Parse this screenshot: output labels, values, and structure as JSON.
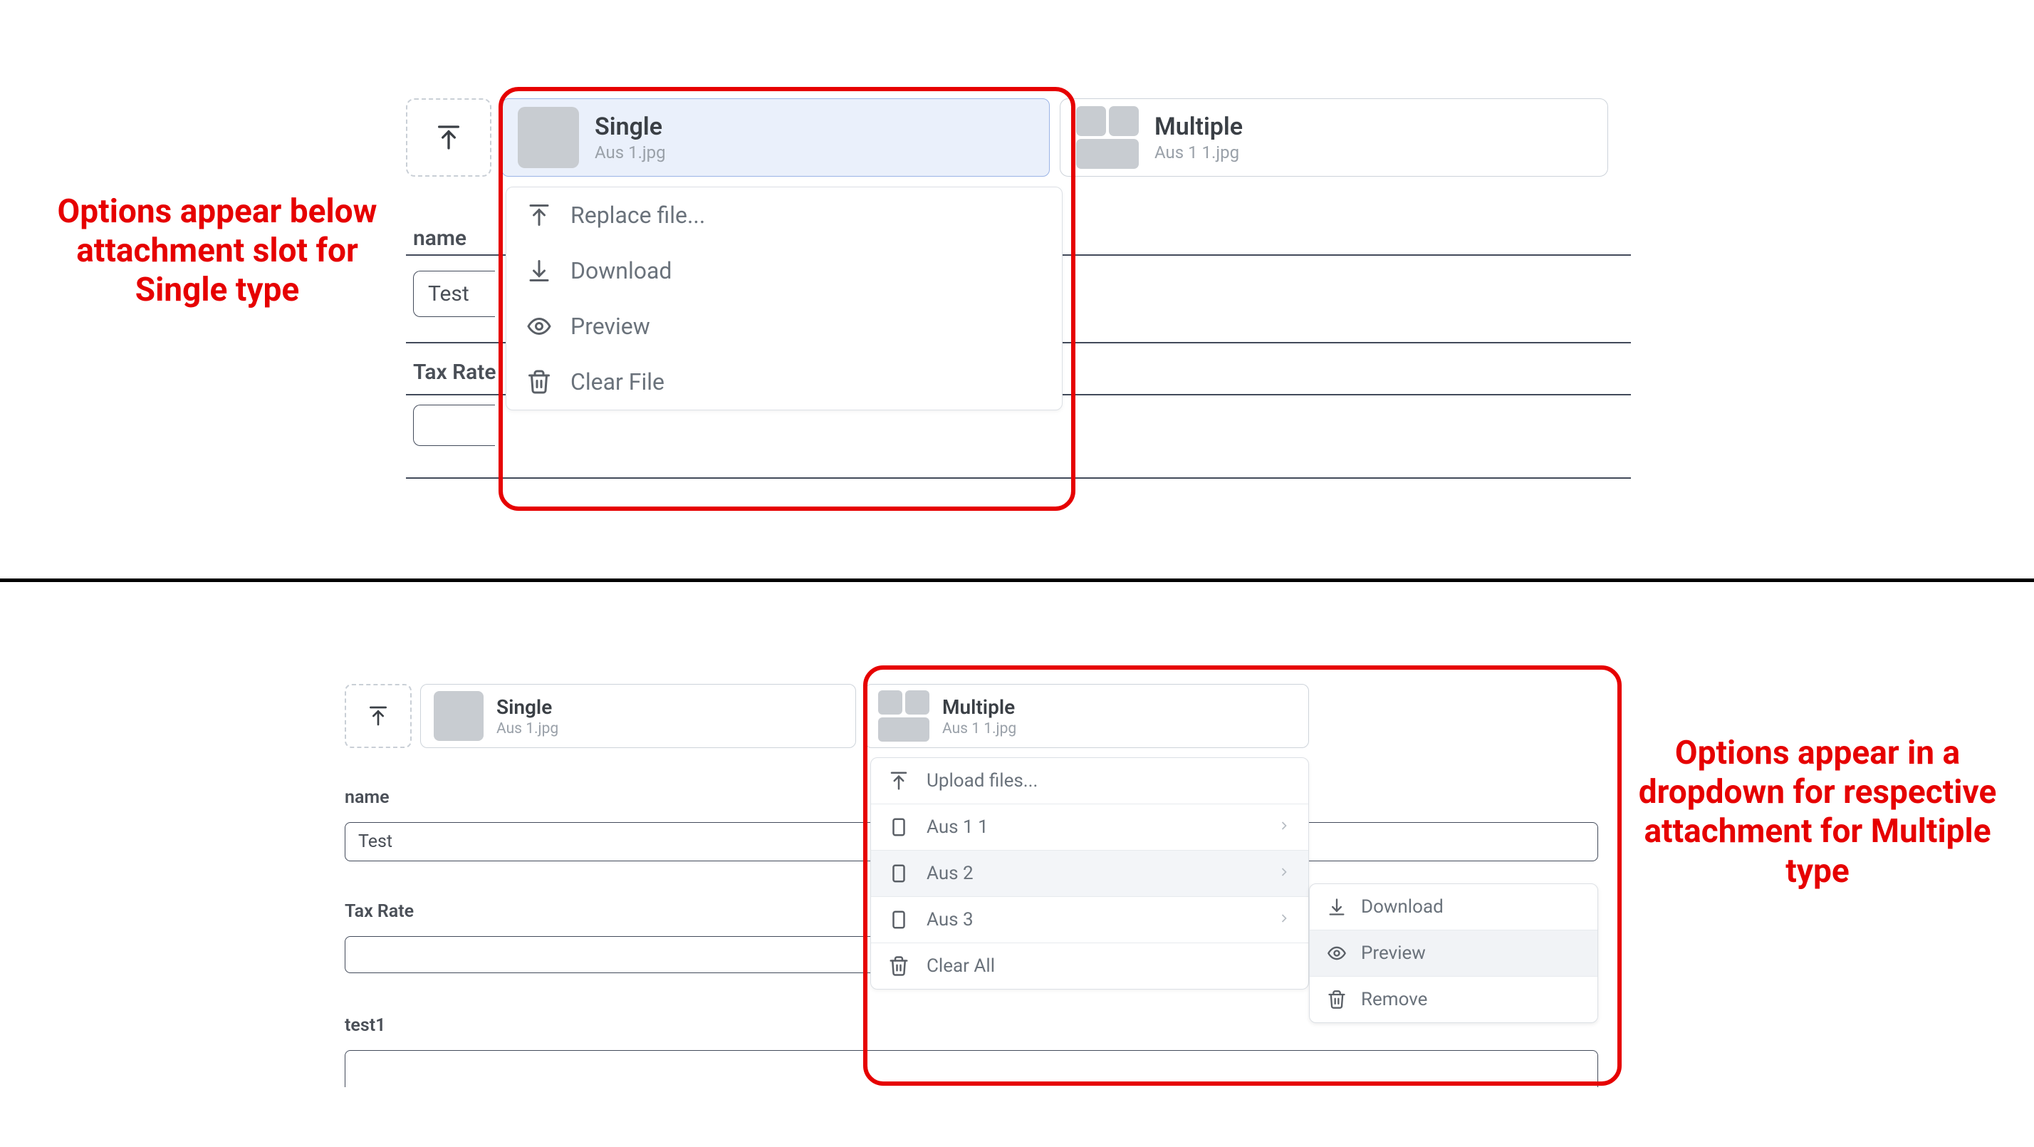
{
  "annotations": {
    "top": "Options appear below attachment slot for Single type",
    "bottom": "Options appear in a dropdown for respective attachment for Multiple type"
  },
  "top": {
    "slots": {
      "single": {
        "title": "Single",
        "subtitle": "Aus 1.jpg"
      },
      "multiple": {
        "title": "Multiple",
        "subtitle": "Aus 1 1.jpg"
      }
    },
    "dropdown": {
      "replace": "Replace file...",
      "download": "Download",
      "preview": "Preview",
      "clear": "Clear File"
    },
    "fields": {
      "name_label": "name",
      "name_value": "Test",
      "tax_label": "Tax Rate",
      "tax_value": ""
    }
  },
  "bottom": {
    "slots": {
      "single": {
        "title": "Single",
        "subtitle": "Aus 1.jpg"
      },
      "multiple": {
        "title": "Multiple",
        "subtitle": "Aus 1 1.jpg"
      }
    },
    "dropdown": {
      "upload": "Upload files...",
      "items": [
        {
          "label": "Aus 1 1"
        },
        {
          "label": "Aus 2"
        },
        {
          "label": "Aus 3"
        }
      ],
      "clear_all": "Clear All"
    },
    "submenu": {
      "download": "Download",
      "preview": "Preview",
      "remove": "Remove"
    },
    "fields": {
      "name_label": "name",
      "name_value": "Test",
      "tax_label": "Tax Rate",
      "tax_value": "",
      "test1_label": "test1"
    }
  }
}
